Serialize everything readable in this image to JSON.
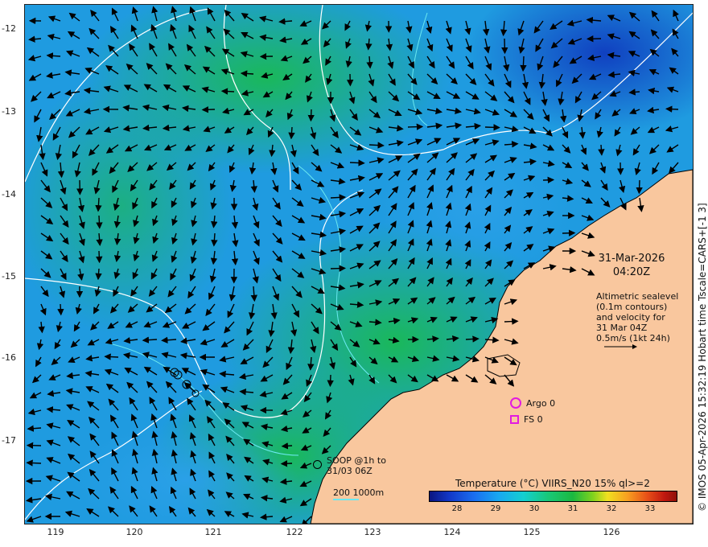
{
  "map": {
    "lat_ticks": [
      "-12",
      "-13",
      "-14",
      "-15",
      "-16",
      "-17"
    ],
    "lon_ticks": [
      "119",
      "120",
      "121",
      "122",
      "123",
      "124",
      "125",
      "126"
    ],
    "colors": {
      "land": "#f9c79e",
      "ocean_cool": "#1c7ff0",
      "ocean_warm": "#1bb04a",
      "contour": "#ffffff",
      "depth_contour": "#6be8f0",
      "vector": "#000000",
      "argo": "#e21be0"
    }
  },
  "annotations": {
    "credit": "© IMOS 05-Apr-2026 15:32:19 Hobart time Tscale=CARS+[-1 3]",
    "date": "31-Mar-2026",
    "time": "04:20Z",
    "altimetry_lines": [
      "Altimetric sealevel",
      "(0.1m contours)",
      "and velocity for",
      "31 Mar 04Z",
      "0.5m/s (1kt 24h)"
    ],
    "argo": "Argo 0",
    "fs": "FS 0",
    "soop_line1": "SOOP @1h to",
    "soop_line2": "31/03 06Z",
    "depth_label": "200  1000m"
  },
  "colorbar": {
    "title": "Temperature (°C) VIIRS_N20 15% ql>=2",
    "ticks": [
      "28",
      "29",
      "30",
      "31",
      "32",
      "33"
    ]
  }
}
